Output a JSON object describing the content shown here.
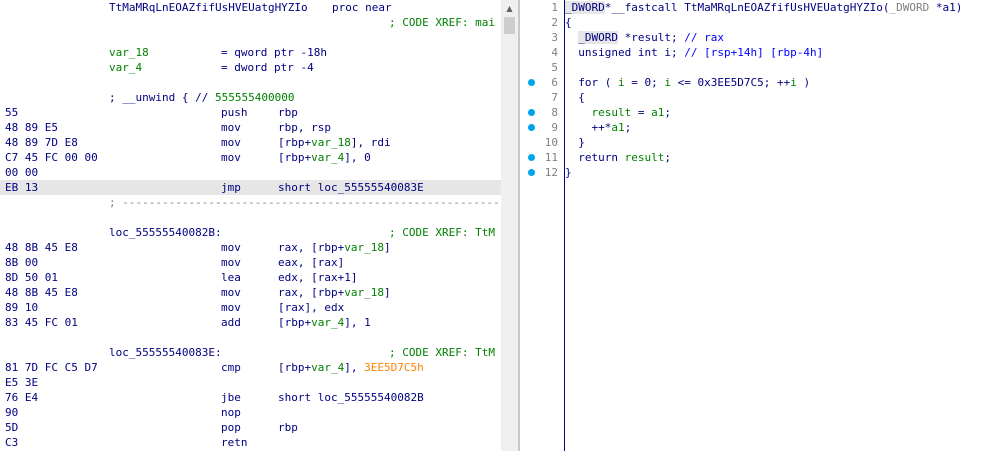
{
  "disasm": {
    "proc_name": "TtMaMRqLnEOAZfifUsHVEUatgHYZIo",
    "proc_kw": "proc near",
    "xref_main": "; CODE XREF: mai",
    "var18_name": "var_18",
    "var18_def": "= qword ptr -18h",
    "var4_name": "var_4",
    "var4_def": "= dword ptr -4",
    "unwind_prefix": "; __unwind { // ",
    "unwind_addr": "555555400000",
    "rows": [
      {
        "bytes": "55",
        "mn": "push",
        "op": "rbp"
      },
      {
        "bytes": "48 89 E5",
        "mn": "mov",
        "op": "rbp, rsp"
      },
      {
        "bytes": "48 89 7D E8",
        "mn": "mov",
        "op_a": "[rbp+",
        "op_var": "var_18",
        "op_b": "], rdi"
      },
      {
        "bytes": "C7 45 FC 00 00",
        "mn": "mov",
        "op_a": "[rbp+",
        "op_var": "var_4",
        "op_b": "], 0"
      },
      {
        "bytes": "00 00"
      },
      {
        "bytes": "EB 13",
        "mn": "jmp",
        "op": "short loc_55555540083E"
      }
    ],
    "dash_line": "; ---------------------------------------------------------------",
    "loc1": "loc_55555540082B:",
    "xref1": "; CODE XREF: TtM",
    "rows2": [
      {
        "bytes": "48 8B 45 E8",
        "mn": "mov",
        "op_a": "rax, [rbp+",
        "op_var": "var_18",
        "op_b": "]"
      },
      {
        "bytes": "8B 00",
        "mn": "mov",
        "op": "eax, [rax]"
      },
      {
        "bytes": "8D 50 01",
        "mn": "lea",
        "op": "edx, [rax+1]"
      },
      {
        "bytes": "48 8B 45 E8",
        "mn": "mov",
        "op_a": "rax, [rbp+",
        "op_var": "var_18",
        "op_b": "]"
      },
      {
        "bytes": "89 10",
        "mn": "mov",
        "op": "[rax], edx"
      },
      {
        "bytes": "83 45 FC 01",
        "mn": "add",
        "op_a": "[rbp+",
        "op_var": "var_4",
        "op_b": "], 1"
      }
    ],
    "loc2": "loc_55555540083E:",
    "xref2": "; CODE XREF: TtM",
    "cmp_row": {
      "bytes": "81 7D FC C5 D7",
      "mn": "cmp",
      "op_a": "[rbp+",
      "op_var": "var_4",
      "op_b": "], ",
      "op_const": "3EE5D7C5h"
    },
    "rows3": [
      {
        "bytes": "E5 3E"
      },
      {
        "bytes": "76 E4",
        "mn": "jbe",
        "op": "short loc_55555540082B"
      },
      {
        "bytes": "90",
        "mn": "nop"
      },
      {
        "bytes": "5D",
        "mn": "pop",
        "op": "rbp"
      },
      {
        "bytes": "C3",
        "mn": "retn"
      }
    ]
  },
  "pseudo": {
    "lines": [
      {
        "n": "1",
        "parts": [
          [
            "hl",
            "_DWORD"
          ],
          [
            "",
            "*__fastcall TtMaMRqLnEOAZfifUsHVEUatgHYZIo("
          ],
          [
            "gray",
            "_DWORD"
          ],
          [
            "",
            " *a1)"
          ]
        ]
      },
      {
        "n": "2",
        "parts": [
          [
            "",
            "{"
          ]
        ]
      },
      {
        "n": "3",
        "parts": [
          [
            "",
            "  "
          ],
          [
            "hl",
            "_DWORD"
          ],
          [
            "",
            " *result; "
          ],
          [
            "blue",
            "// rax"
          ]
        ]
      },
      {
        "n": "4",
        "parts": [
          [
            "",
            "  unsigned int i; "
          ],
          [
            "blue",
            "// [rsp+14h] [rbp-4h]"
          ]
        ]
      },
      {
        "n": "5",
        "parts": []
      },
      {
        "n": "6",
        "dot": true,
        "parts": [
          [
            "",
            "  for ( "
          ],
          [
            "green",
            "i"
          ],
          [
            "",
            " = 0; "
          ],
          [
            "green",
            "i"
          ],
          [
            "",
            " <= 0x3EE5D7C5; ++"
          ],
          [
            "green",
            "i"
          ],
          [
            "",
            " )"
          ]
        ]
      },
      {
        "n": "7",
        "parts": [
          [
            "",
            "  {"
          ]
        ]
      },
      {
        "n": "8",
        "dot": true,
        "parts": [
          [
            "",
            "    "
          ],
          [
            "green",
            "result"
          ],
          [
            "",
            " = "
          ],
          [
            "green",
            "a1"
          ],
          [
            "",
            ";"
          ]
        ]
      },
      {
        "n": "9",
        "dot": true,
        "parts": [
          [
            "",
            "    ++*"
          ],
          [
            "green",
            "a1"
          ],
          [
            "",
            ";"
          ]
        ]
      },
      {
        "n": "10",
        "parts": [
          [
            "",
            "  }"
          ]
        ]
      },
      {
        "n": "11",
        "dot": true,
        "parts": [
          [
            "",
            "  return "
          ],
          [
            "green",
            "result"
          ],
          [
            "",
            ";"
          ]
        ]
      },
      {
        "n": "12",
        "dot": true,
        "parts": [
          [
            "",
            "}"
          ]
        ]
      }
    ]
  },
  "colors": {
    "accent": "#00a2e8",
    "navy": "#000080",
    "comment": "#008000",
    "const": "#ff8000",
    "selection": "#e6e6e6"
  }
}
